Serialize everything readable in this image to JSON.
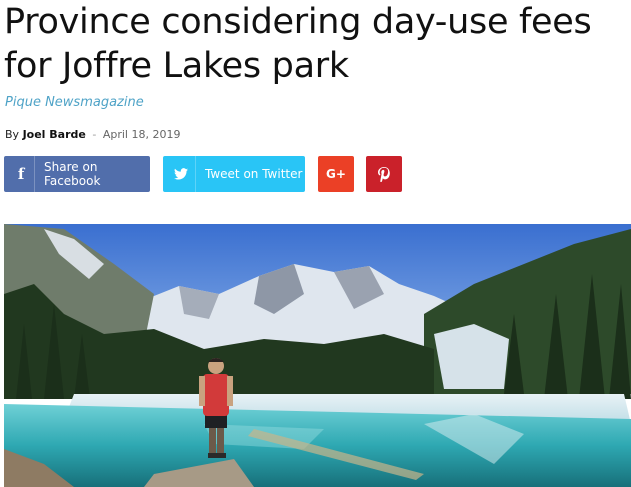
{
  "article": {
    "headline": "Province considering day-use fees for Joffre Lakes park",
    "source": "Pique Newsmagazine",
    "byline": {
      "prefix": "By",
      "author": "Joel Barde",
      "separator": "-",
      "date": "April 18, 2019"
    }
  },
  "share": {
    "facebook": {
      "icon": "facebook-icon",
      "label": "Share on Facebook",
      "color": "#516eab"
    },
    "twitter": {
      "icon": "twitter-icon",
      "label": "Tweet on Twitter",
      "color": "#29c5f6"
    },
    "google_plus": {
      "icon": "google-plus-icon",
      "glyph": "G+",
      "color": "#eb4026"
    },
    "pinterest": {
      "icon": "pinterest-icon",
      "glyph": "P",
      "color": "#ca212a"
    }
  }
}
